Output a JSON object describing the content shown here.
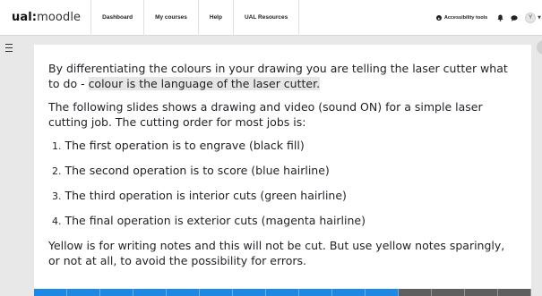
{
  "header": {
    "logo_part1": "ual:",
    "logo_part2": "moodle",
    "nav": [
      "Dashboard",
      "My courses",
      "Help",
      "UAL Resources"
    ],
    "accessibility_label": "Accessibility tools",
    "avatar_initial": "Y"
  },
  "content": {
    "para1_part1": "By differentiating the colours in your drawing you are telling the laser cutter what to do - ",
    "para1_highlight": "colour is the language of the laser cutter.",
    "para2": "The following slides shows a drawing and video (sound ON) for a simple laser cutting job. The cutting order for most jobs is:",
    "steps": [
      {
        "num": "1.",
        "text": "The first operation is to engrave (black fill)"
      },
      {
        "num": "2.",
        "text": "The second operation is to score (blue hairline)"
      },
      {
        "num": "3.",
        "text": "The third operation is interior cuts (green hairline)"
      },
      {
        "num": "4.",
        "text": "The final operation is exterior cuts (magenta hairline)"
      }
    ],
    "para3": "Yellow is for writing notes and this will not be cut. But use yellow notes sparingly, or not at all, to avoid the possibility for errors."
  },
  "progress": {
    "completed_segments": 11,
    "total_segments": 15,
    "color_done": "#1e88e5",
    "color_todo": "#5f5f5f"
  }
}
